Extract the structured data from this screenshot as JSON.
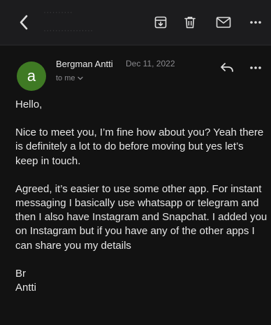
{
  "topbar": {
    "ghost_line_1": "··········",
    "ghost_line_2": "·················",
    "icons": [
      "back-icon",
      "archive-icon",
      "trash-icon",
      "mail-icon",
      "more-icon"
    ]
  },
  "message": {
    "avatar_letter": "a",
    "avatar_color": "#3f7a24",
    "sender": "Bergman Antti",
    "date": "Dec 11, 2022",
    "recipient": "to me",
    "body": {
      "greeting": "Hello,",
      "paragraph_1": "Nice to meet you, I’m fine how about you? Yeah there is definitely a lot to do before moving but yes let’s keep in touch.",
      "paragraph_2": "Agreed, it’s easier to use some other app. For instant messaging I basically use whatsapp or telegram and then I also have Instagram and Snapchat. I added you on Instagram but if you have any of the other apps I can share you my details",
      "closing": "Br",
      "signature": "Antti"
    }
  }
}
